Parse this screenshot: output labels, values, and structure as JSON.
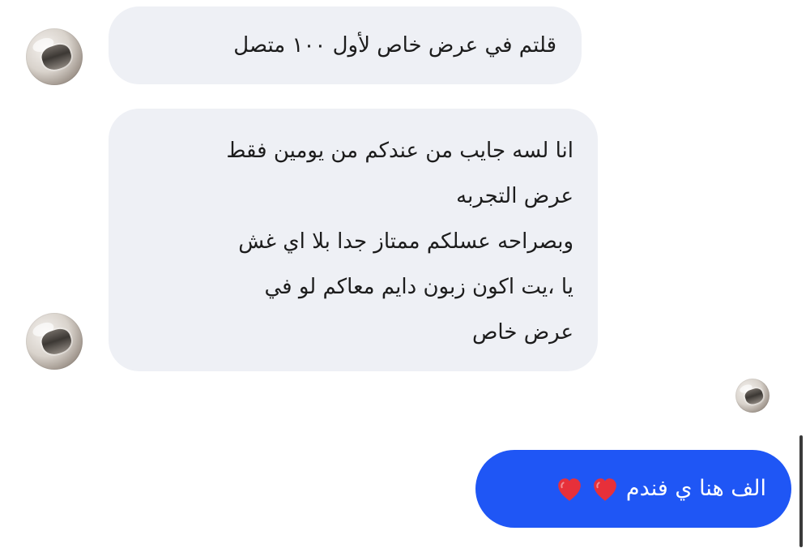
{
  "messages": {
    "incoming_1": {
      "text": "قلتم في عرض خاص لأول ١٠٠ متصل"
    },
    "incoming_2": {
      "lines": [
        "انا لسه جايب من عندكم من يومين فقط",
        "عرض التجربه",
        "وبصراحه عسلكم ممتاز جدا بلا اي غش",
        "يا ،يت اكون زبون دايم معاكم لو في",
        "عرض خاص"
      ]
    },
    "outgoing_1": {
      "text": "الف هنا ي فندم",
      "emoji": "❤️❤️"
    }
  },
  "colors": {
    "incoming_bubble": "#eef0f5",
    "outgoing_bubble": "#1f56f5",
    "heart": "#e7303a"
  },
  "icons": {
    "avatar": "profile-photo-jar",
    "heart": "red-heart-emoji"
  }
}
